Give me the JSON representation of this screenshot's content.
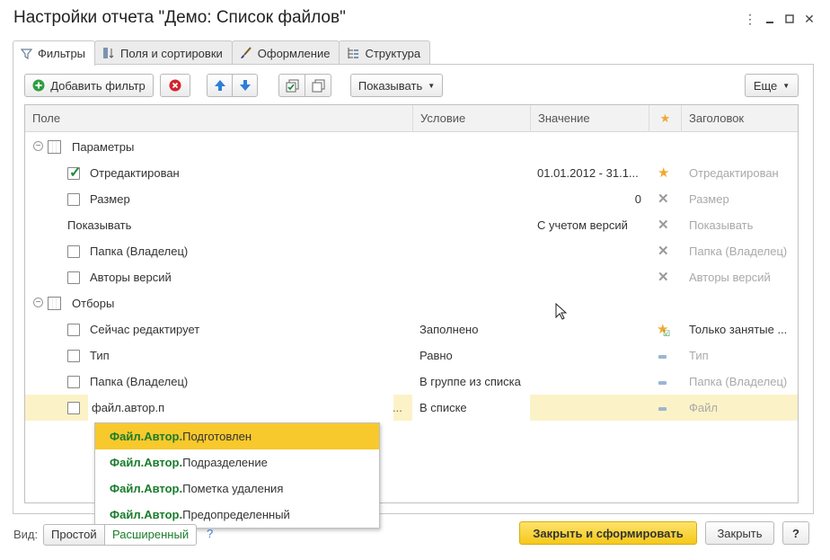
{
  "window": {
    "title": "Настройки отчета \"Демо: Список файлов\""
  },
  "tabs": [
    {
      "label": "Фильтры",
      "icon": "funnel-icon",
      "active": true
    },
    {
      "label": "Поля и сортировки",
      "icon": "fields-sort-icon"
    },
    {
      "label": "Оформление",
      "icon": "brush-icon"
    },
    {
      "label": "Структура",
      "icon": "structure-tree-icon"
    }
  ],
  "toolbar": {
    "add_filter": "Добавить фильтр",
    "show": "Показывать",
    "more": "Еще"
  },
  "columns": {
    "field": "Поле",
    "condition": "Условие",
    "value": "Значение",
    "title": "Заголовок"
  },
  "groups": {
    "params": "Параметры",
    "filters": "Отборы"
  },
  "rows": [
    {
      "field": "Отредактирован",
      "checked": true,
      "value": "01.01.2012 - 31.1...",
      "title": "Отредактирован",
      "state": "star"
    },
    {
      "field": "Размер",
      "checked": false,
      "value": "0",
      "title": "Размер",
      "state": "x"
    },
    {
      "field": "Показывать",
      "value": "С учетом версий",
      "title": "Показывать",
      "state": "x"
    },
    {
      "field": "Папка (Владелец)",
      "checked": false,
      "title": "Папка (Владелец)",
      "state": "x"
    },
    {
      "field": "Авторы версий",
      "checked": false,
      "title": "Авторы версий",
      "state": "x"
    },
    {
      "field": "Сейчас редактирует",
      "checked": false,
      "condition": "Заполнено",
      "title": "Только занятые ...",
      "state": "star-check"
    },
    {
      "field": "Тип",
      "checked": false,
      "condition": "Равно",
      "title": "Тип",
      "state": "dash"
    },
    {
      "field": "Папка (Владелец)",
      "checked": false,
      "condition": "В группе из списка",
      "title": "Папка (Владелец)",
      "state": "dash"
    },
    {
      "field": "файл.автор.п",
      "checked": false,
      "condition": "В списке",
      "title": "Файл",
      "state": "dash",
      "editing": true,
      "ellipsis": "..."
    }
  ],
  "autocomplete": [
    {
      "prefix": "Файл.Автор.",
      "rest": "Подготовлен",
      "highlighted": true
    },
    {
      "prefix": "Файл.Автор.",
      "rest": "Подразделение"
    },
    {
      "prefix": "Файл.Автор.",
      "rest": "Пометка удаления"
    },
    {
      "prefix": "Файл.Автор.",
      "rest": "Предопределенный"
    }
  ],
  "footer": {
    "view_label": "Вид:",
    "simple": "Простой",
    "advanced": "Расширенный",
    "help_mark": "?",
    "close_generate": "Закрыть и сформировать",
    "close": "Закрыть",
    "help": "?"
  },
  "colors": {
    "accent": "#f8c92c",
    "green": "#1a7c2c",
    "selected_row": "#fcf2c7"
  }
}
